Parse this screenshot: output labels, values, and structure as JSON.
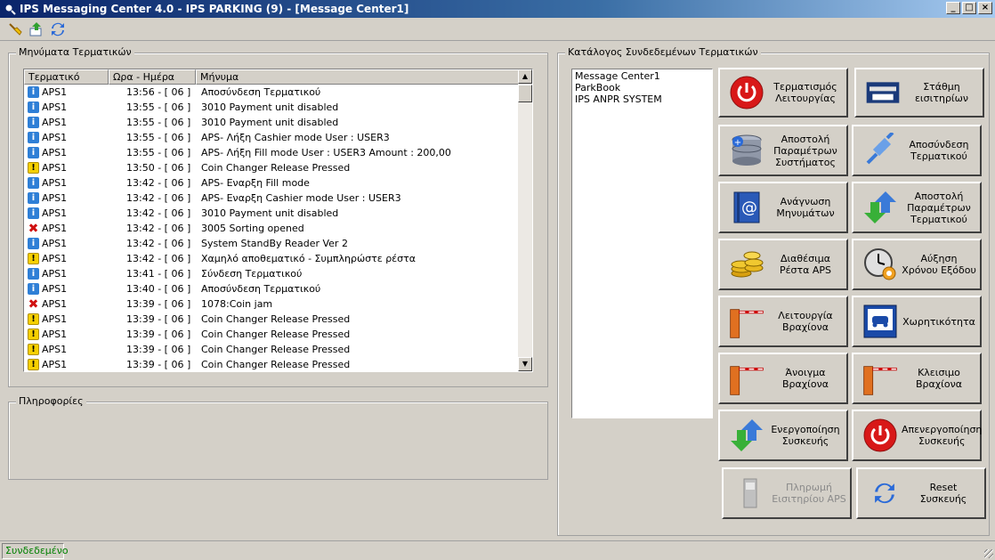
{
  "window": {
    "title": "IPS Messaging Center 4.0 - IPS PARKING (9) - [Message Center1]"
  },
  "toolbar": {
    "icons": [
      "broom-icon",
      "upload-icon",
      "refresh-icon"
    ]
  },
  "messages": {
    "legend": "Μηνύματα Τερματικών",
    "columns": [
      "Τερματικό",
      "Ωρα - Ημέρα",
      "Μήνυμα"
    ],
    "rows": [
      {
        "type": "info",
        "terminal": "APS1",
        "time": "13:56 - [ 06 ]",
        "message": "Αποσύνδεση Τερματικού"
      },
      {
        "type": "info",
        "terminal": "APS1",
        "time": "13:55 - [ 06 ]",
        "message": "3010 Payment unit disabled"
      },
      {
        "type": "info",
        "terminal": "APS1",
        "time": "13:55 - [ 06 ]",
        "message": "3010 Payment unit disabled"
      },
      {
        "type": "info",
        "terminal": "APS1",
        "time": "13:55 - [ 06 ]",
        "message": "APS- Λήξη Cashier mode User : USER3"
      },
      {
        "type": "info",
        "terminal": "APS1",
        "time": "13:55 - [ 06 ]",
        "message": "APS- Λήξη Fill mode User : USER3  Amount :  200,00"
      },
      {
        "type": "warn",
        "terminal": "APS1",
        "time": "13:50 - [ 06 ]",
        "message": "Coin Changer Release Pressed"
      },
      {
        "type": "info",
        "terminal": "APS1",
        "time": "13:42 - [ 06 ]",
        "message": "APS- Εναρξη Fill mode"
      },
      {
        "type": "info",
        "terminal": "APS1",
        "time": "13:42 - [ 06 ]",
        "message": "APS- Εναρξη Cashier mode User : USER3"
      },
      {
        "type": "info",
        "terminal": "APS1",
        "time": "13:42 - [ 06 ]",
        "message": "3010 Payment unit disabled"
      },
      {
        "type": "err",
        "terminal": "APS1",
        "time": "13:42 - [ 06 ]",
        "message": "3005 Sorting opened"
      },
      {
        "type": "info",
        "terminal": "APS1",
        "time": "13:42 - [ 06 ]",
        "message": "System StandBy Reader Ver 2"
      },
      {
        "type": "warn",
        "terminal": "APS1",
        "time": "13:42 - [ 06 ]",
        "message": "Χαμηλό αποθεματικό - Συμπληρώστε ρέστα"
      },
      {
        "type": "info",
        "terminal": "APS1",
        "time": "13:41 - [ 06 ]",
        "message": "Σύνδεση Τερματικού"
      },
      {
        "type": "info",
        "terminal": "APS1",
        "time": "13:40 - [ 06 ]",
        "message": "Αποσύνδεση Τερματικού"
      },
      {
        "type": "err",
        "terminal": "APS1",
        "time": "13:39 - [ 06 ]",
        "message": "1078:Coin jam"
      },
      {
        "type": "warn",
        "terminal": "APS1",
        "time": "13:39 - [ 06 ]",
        "message": "Coin Changer Release Pressed"
      },
      {
        "type": "warn",
        "terminal": "APS1",
        "time": "13:39 - [ 06 ]",
        "message": "Coin Changer Release Pressed"
      },
      {
        "type": "warn",
        "terminal": "APS1",
        "time": "13:39 - [ 06 ]",
        "message": "Coin Changer Release Pressed"
      },
      {
        "type": "warn",
        "terminal": "APS1",
        "time": "13:39 - [ 06 ]",
        "message": "Coin Changer Release Pressed"
      }
    ]
  },
  "info": {
    "legend": "Πληροφορίες"
  },
  "terminals": {
    "legend": "Κατάλογος Συνδεδεμένων Τερματικών",
    "items": [
      "Message Center1",
      "ParkBook",
      "IPS ANPR SYSTEM"
    ]
  },
  "buttons": {
    "shutdown": "Τερματισμός Λειτουργίας",
    "ticket_level": "Στάθμη εισιτηρίων",
    "send_system_params": "Αποστολή Παραμέτρων Συστήματος",
    "disconnect_terminal": "Αποσύνδεση Τερματικού",
    "read_messages": "Ανάγνωση Μηνυμάτων",
    "send_terminal_params": "Αποστολή Παραμέτρων Τερματικού",
    "available_change": "Διαθέσιμα Ρέστα APS",
    "increase_exit_time": "Αύξηση Χρόνου Εξόδου",
    "barrier_operation": "Λειτουργία Βραχίονα",
    "capacity": "Χωρητικότητα",
    "open_barrier": "Άνοιγμα Βραχίονα",
    "close_barrier": "Κλεισιμο Βραχίονα",
    "enable_device": "Ενεργοποίηση Συσκευής",
    "disable_device": "Απενεργοποίηση Συσκευής",
    "ticket_payment": "Πληρωμή Εισιτηρίου APS",
    "reset_device": "Reset Συσκευής"
  },
  "status": {
    "text": "Συνδεδεμένο",
    "color": "#008000"
  }
}
